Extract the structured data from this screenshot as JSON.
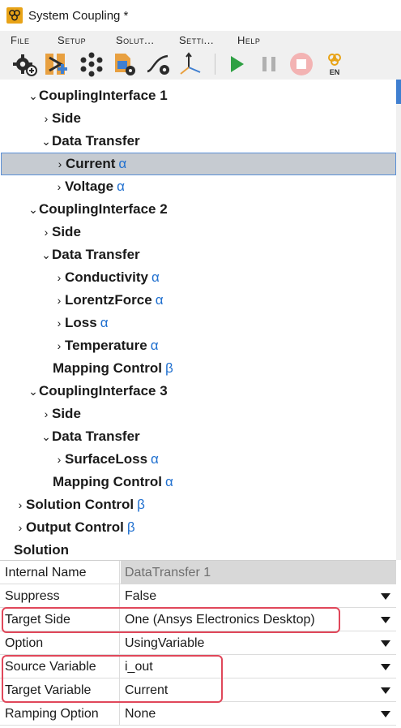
{
  "window": {
    "title": "System Coupling *"
  },
  "menu": [
    {
      "label": "File"
    },
    {
      "label": "Setup"
    },
    {
      "label": "Solut..."
    },
    {
      "label": "Setti..."
    },
    {
      "label": "Help"
    }
  ],
  "toolbar": {
    "items": [
      {
        "icon": "add-gear-icon"
      },
      {
        "icon": "add-participant-icon"
      },
      {
        "icon": "dots-ring-icon"
      },
      {
        "icon": "document-settings-icon"
      },
      {
        "icon": "curve-gear-icon"
      },
      {
        "icon": "axes-icon"
      },
      {
        "icon": "play-icon",
        "color": "#2ea043"
      },
      {
        "icon": "pause-icon",
        "color": "#b0b0b0"
      },
      {
        "icon": "stop-icon",
        "color": "#f0a0a0"
      },
      {
        "icon": "language-icon",
        "label": "EN"
      }
    ]
  },
  "tree": {
    "greek_color": "#1f6fcf",
    "items": [
      {
        "label": "CouplingInterface 1",
        "chevron": "⌄",
        "greek": ""
      },
      {
        "label": "Side",
        "chevron": "›",
        "greek": ""
      },
      {
        "label": "Data Transfer",
        "chevron": "⌄",
        "greek": ""
      },
      {
        "label": "Current",
        "chevron": "›",
        "greek": "α",
        "selected": true
      },
      {
        "label": "Voltage",
        "chevron": "›",
        "greek": "α"
      },
      {
        "label": "CouplingInterface 2",
        "chevron": "⌄",
        "greek": ""
      },
      {
        "label": "Side",
        "chevron": "›",
        "greek": ""
      },
      {
        "label": "Data Transfer",
        "chevron": "⌄",
        "greek": ""
      },
      {
        "label": "Conductivity",
        "chevron": "›",
        "greek": "α"
      },
      {
        "label": "LorentzForce",
        "chevron": "›",
        "greek": "α"
      },
      {
        "label": "Loss",
        "chevron": "›",
        "greek": "α"
      },
      {
        "label": "Temperature",
        "chevron": "›",
        "greek": "α"
      },
      {
        "label": "Mapping Control",
        "chevron": "",
        "greek": "β"
      },
      {
        "label": "CouplingInterface 3",
        "chevron": "⌄",
        "greek": ""
      },
      {
        "label": "Side",
        "chevron": "›",
        "greek": ""
      },
      {
        "label": "Data Transfer",
        "chevron": "⌄",
        "greek": ""
      },
      {
        "label": "SurfaceLoss",
        "chevron": "›",
        "greek": "α"
      },
      {
        "label": "Mapping Control",
        "chevron": "",
        "greek": "α"
      },
      {
        "label": "Solution Control",
        "chevron": "›",
        "greek": "β"
      },
      {
        "label": "Output Control",
        "chevron": "›",
        "greek": "β"
      },
      {
        "label": "Solution",
        "chevron": "",
        "greek": ""
      }
    ]
  },
  "properties": {
    "rows": [
      {
        "name": "Internal Name",
        "value": "DataTransfer 1",
        "readonly": true
      },
      {
        "name": "Suppress",
        "value": "False"
      },
      {
        "name": "Target Side",
        "value": "One (Ansys Electronics Desktop)"
      },
      {
        "name": "Option",
        "value": "UsingVariable"
      },
      {
        "name": "Source Variable",
        "value": "i_out"
      },
      {
        "name": "Target Variable",
        "value": "Current"
      },
      {
        "name": "Ramping Option",
        "value": "None"
      }
    ],
    "highlight_color": "#e0475a"
  }
}
